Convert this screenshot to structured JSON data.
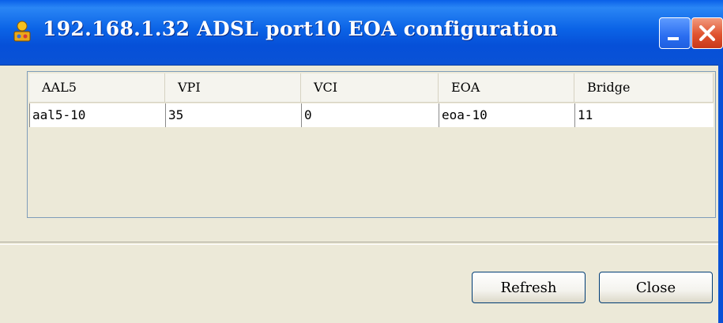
{
  "window": {
    "title": "192.168.1.32 ADSL port10 EOA configuration",
    "titlebar_color": "#0b63e6",
    "close_color": "#e0532f"
  },
  "table": {
    "columns": [
      "AAL5",
      "VPI",
      "VCI",
      "EOA",
      "Bridge"
    ],
    "rows": [
      [
        "aal5-10",
        "35",
        "0",
        "eoa-10",
        "11"
      ]
    ]
  },
  "buttons": {
    "refresh": "Refresh",
    "close": "Close"
  }
}
